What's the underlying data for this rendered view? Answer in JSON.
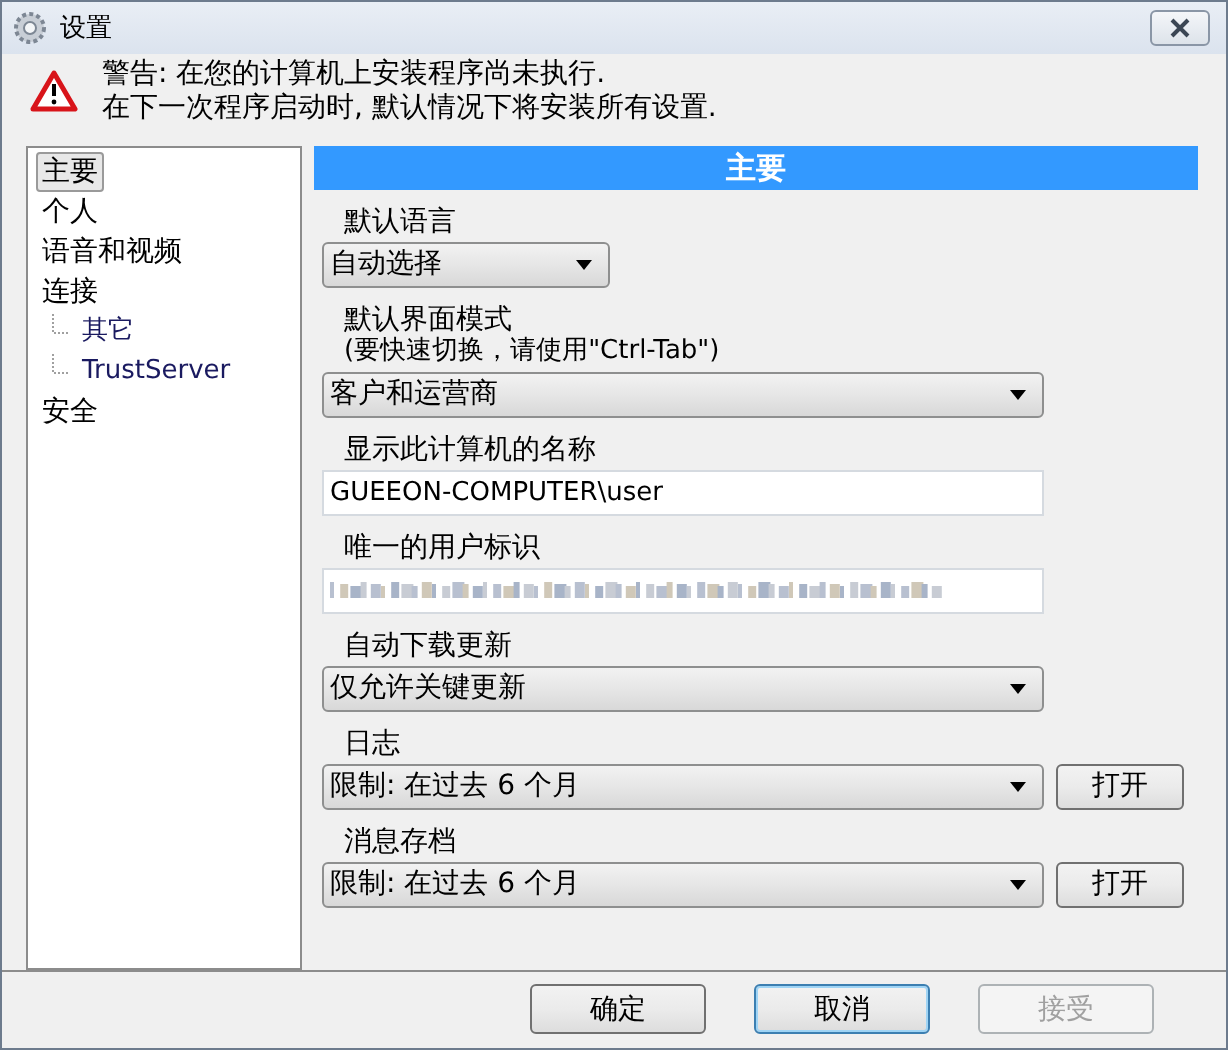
{
  "window": {
    "title": "设置"
  },
  "warning": {
    "lines": [
      "警告: 在您的计算机上安装程序尚未执行.",
      "在下一次程序启动时, 默认情况下将安装所有设置."
    ]
  },
  "sidebar": {
    "items": [
      {
        "label": "主要",
        "selected": true
      },
      {
        "label": "个人",
        "selected": false
      },
      {
        "label": "语音和视频",
        "selected": false
      },
      {
        "label": "连接",
        "selected": false,
        "children": [
          {
            "label": "其它",
            "selected": false
          },
          {
            "label": "TrustServer",
            "selected": false
          }
        ]
      },
      {
        "label": "安全",
        "selected": false
      }
    ]
  },
  "panel": {
    "title": "主要",
    "fields": [
      {
        "kind": "short-dropdown",
        "label": "默认语言",
        "value": "自动选择"
      },
      {
        "kind": "dropdown",
        "label": "默认界面模式",
        "note": "(要快速切换，请使用\"Ctrl-Tab\")",
        "value": "客户和运营商"
      },
      {
        "kind": "text",
        "label": "显示此计算机的名称",
        "value": "GUEEON-COMPUTER\\user"
      },
      {
        "kind": "redacted",
        "label": "唯一的用户标识"
      },
      {
        "kind": "dropdown",
        "label": "自动下载更新",
        "value": "仅允许关键更新"
      },
      {
        "kind": "dropdown",
        "label": "日志",
        "value": "限制: 在过去 6 个月",
        "button": "打开"
      },
      {
        "kind": "dropdown",
        "label": "消息存档",
        "value": "限制: 在过去 6 个月",
        "button": "打开"
      }
    ]
  },
  "buttons": [
    {
      "label": "确定",
      "disabled": false,
      "focused": false
    },
    {
      "label": "取消",
      "disabled": false,
      "focused": true
    },
    {
      "label": "接受",
      "disabled": true,
      "focused": false
    }
  ]
}
